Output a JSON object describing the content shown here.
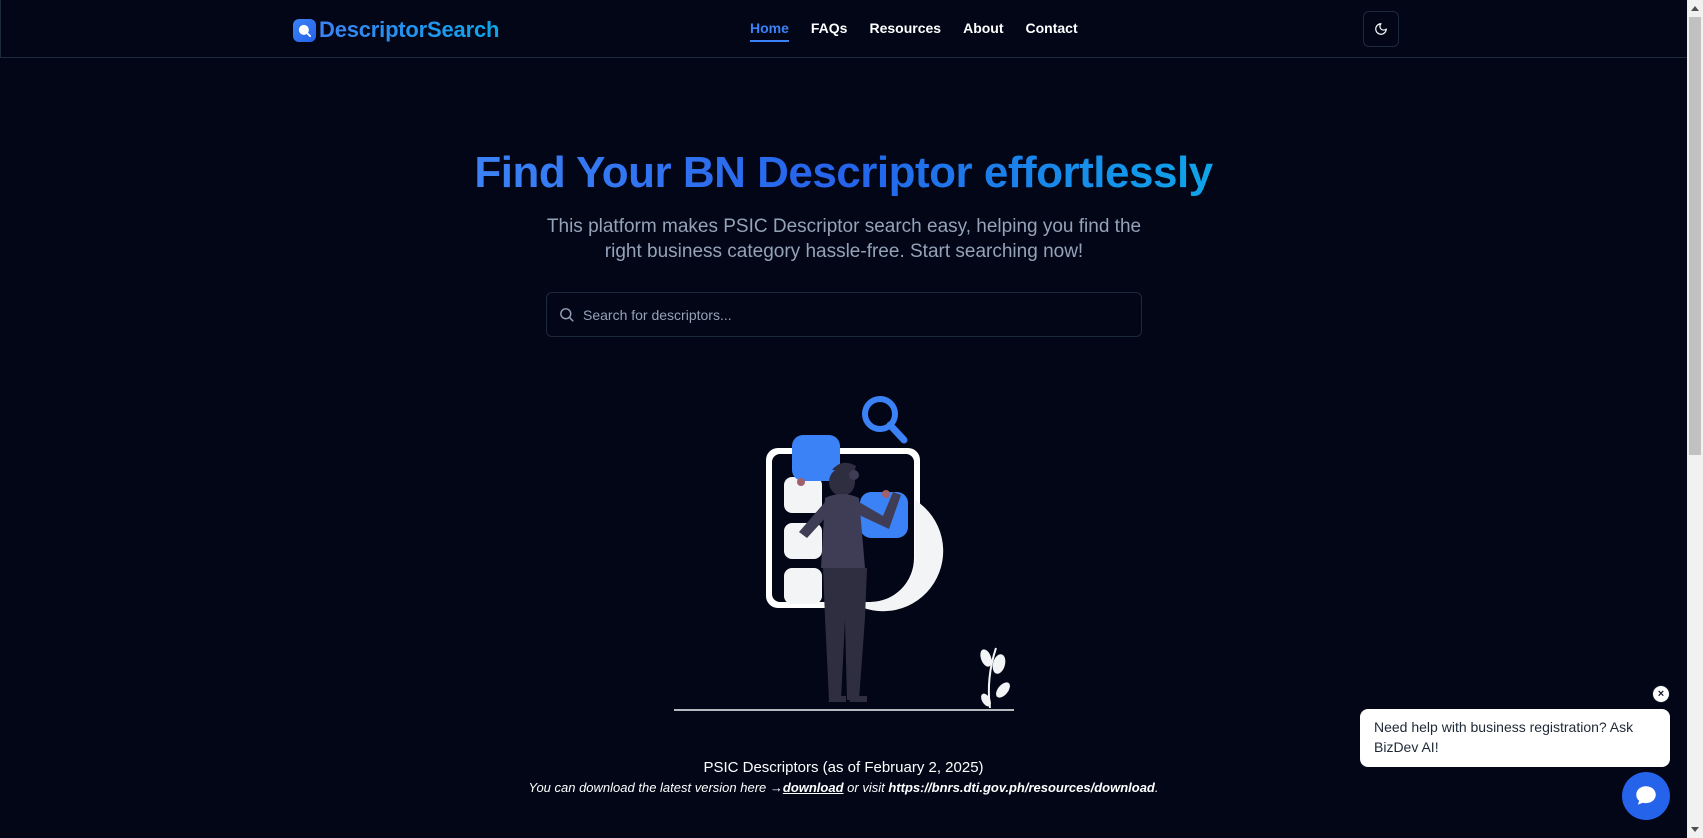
{
  "header": {
    "logo_text": "DescriptorSearch",
    "nav": [
      {
        "label": "Home",
        "active": true
      },
      {
        "label": "FAQs",
        "active": false
      },
      {
        "label": "Resources",
        "active": false
      },
      {
        "label": "About",
        "active": false
      },
      {
        "label": "Contact",
        "active": false
      }
    ],
    "theme_toggle_icon": "moon-icon"
  },
  "hero": {
    "title": "Find Your BN Descriptor effortlessly",
    "subtitle": "This platform makes PSIC Descriptor search easy, helping you find the right business category hassle-free. Start searching now!"
  },
  "search": {
    "placeholder": "Search for descriptors...",
    "value": "",
    "icon": "search-icon"
  },
  "psic": {
    "title": "PSIC Descriptors (as of February 2, 2025)",
    "line_prefix": "You can download the latest version here →",
    "download_label": "download",
    "line_middle": " or visit ",
    "url": "https://bnrs.dti.gov.ph/resources/download",
    "line_suffix": "."
  },
  "chat": {
    "message": "Need help with business registration? Ask BizDev AI!",
    "close_label": "×",
    "button_icon": "chat-icon"
  },
  "colors": {
    "background": "#020617",
    "accent": "#3b82f6",
    "muted_text": "#94a3b8",
    "border": "#1e293b"
  }
}
